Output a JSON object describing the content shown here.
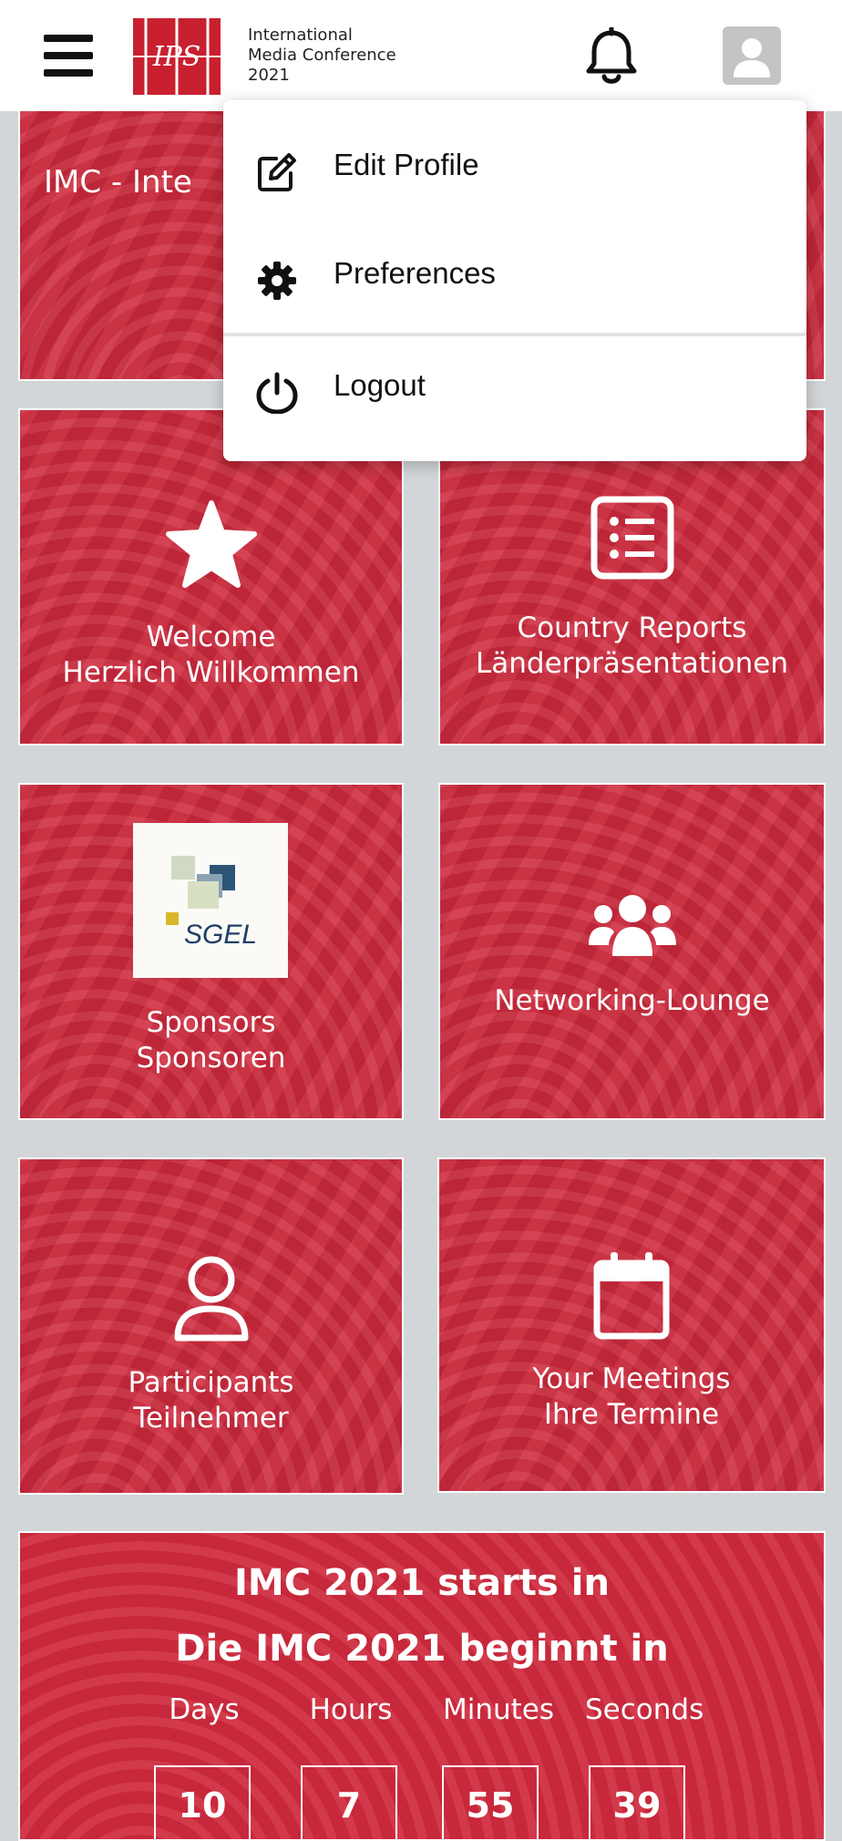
{
  "header": {
    "brand_line1": "International",
    "brand_line2": "Media Conference",
    "brand_line3": "2021",
    "logo_text": "IPS"
  },
  "banner": {
    "title": "IMC - Inte"
  },
  "menu": {
    "items": [
      {
        "label": "Edit Profile",
        "icon": "edit-icon"
      },
      {
        "label": "Preferences",
        "icon": "gear-icon"
      },
      {
        "label": "Logout",
        "icon": "power-icon"
      }
    ]
  },
  "tiles": {
    "welcome": {
      "line1": "Welcome",
      "line2": "Herzlich Willkommen"
    },
    "country_reports": {
      "line1": "Country Reports",
      "line2": "Länderpräsentationen"
    },
    "sponsors": {
      "line1": "Sponsors",
      "line2": "Sponsoren",
      "logo_text": "SGEL"
    },
    "networking": {
      "line1": "Networking-Lounge"
    },
    "participants": {
      "line1": "Participants",
      "line2": "Teilnehmer"
    },
    "meetings": {
      "line1": "Your Meetings",
      "line2": "Ihre Termine"
    }
  },
  "countdown": {
    "line1": "IMC 2021 starts in",
    "line2": "Die IMC 2021 beginnt in",
    "units": [
      {
        "label": "Days",
        "value": "10"
      },
      {
        "label": "Hours",
        "value": "7"
      },
      {
        "label": "Minutes",
        "value": "55"
      },
      {
        "label": "Seconds",
        "value": "39"
      }
    ]
  },
  "colors": {
    "accent": "#cf2a3d",
    "background": "#d3d6d8"
  }
}
